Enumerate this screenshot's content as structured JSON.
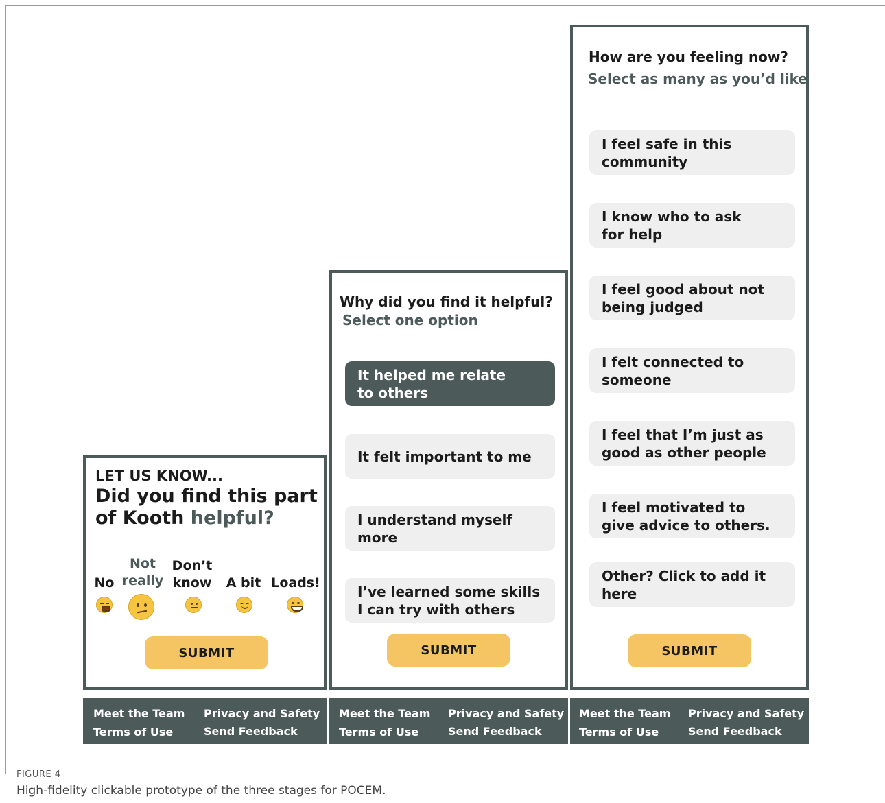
{
  "colors": {
    "accent": "#4d5a5a",
    "submit": "#f4c562",
    "option_bg": "#efefef"
  },
  "panel1": {
    "kicker": "LET US KNOW...",
    "question_prefix": "Did you find this part of Kooth ",
    "question_accent": "helpful?",
    "ratings": [
      {
        "label": "No",
        "emoji": "tired-face-icon"
      },
      {
        "label": "Not really",
        "emoji": "confused-face-icon",
        "selected": true
      },
      {
        "label": "Don’t know",
        "emoji": "neutral-face-icon"
      },
      {
        "label": "A bit",
        "emoji": "relieved-face-icon"
      },
      {
        "label": "Loads!",
        "emoji": "grinning-face-icon"
      }
    ],
    "submit": "SUBMIT"
  },
  "panel2": {
    "title": "Why did you find it helpful?",
    "subtitle": "Select one option",
    "options": [
      "It helped me relate to others",
      "It felt important to me",
      "I understand myself more",
      "I’ve learned some skills I can try with others"
    ],
    "selected_index": 0,
    "submit": "SUBMIT"
  },
  "panel3": {
    "title": "How are you feeling now?",
    "subtitle": "Select as many as you’d like",
    "options": [
      "I feel safe in this community",
      "I know who to ask for help",
      "I feel good about not being judged",
      "I felt connected to someone",
      "I feel that I’m just as good as other people",
      "I feel motivated to give advice to others.",
      "Other? Click to add it here"
    ],
    "submit": "SUBMIT"
  },
  "footer": {
    "meet_team": "Meet the Team",
    "privacy": "Privacy and Safety",
    "terms": "Terms of Use",
    "feedback": "Send Feedback"
  },
  "figure": {
    "label": "FIGURE 4",
    "caption": "High-fidelity clickable prototype of the three stages for POCEM."
  }
}
